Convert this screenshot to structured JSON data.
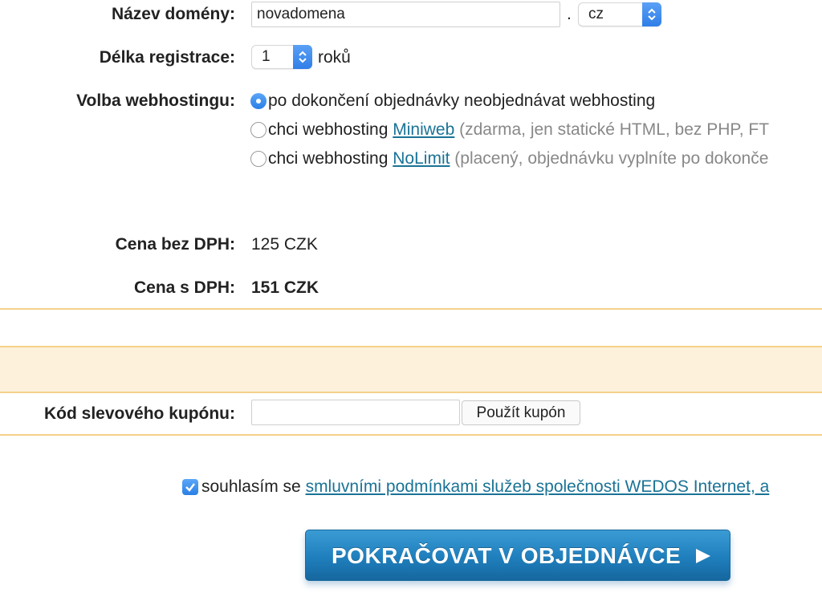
{
  "domain_name": {
    "label": "Název domény:",
    "value": "novadomena",
    "dot": ".",
    "tld": "cz"
  },
  "registration": {
    "label": "Délka registrace:",
    "value": "1",
    "unit": "roků"
  },
  "webhosting": {
    "label": "Volba webhostingu:",
    "options": [
      {
        "text": "po dokončení objednávky neobjednávat webhosting",
        "selected": true
      },
      {
        "prefix": "chci webhosting ",
        "link": "Miniweb",
        "note": " (zdarma, jen statické HTML, bez PHP, FT",
        "selected": false
      },
      {
        "prefix": "chci webhosting ",
        "link": "NoLimit",
        "note": " (placený, objednávku vyplníte po dokonče",
        "selected": false
      }
    ]
  },
  "price": {
    "without_vat_label": "Cena bez DPH:",
    "without_vat": "125 CZK",
    "with_vat_label": "Cena s DPH:",
    "with_vat": "151 CZK"
  },
  "coupon": {
    "label": "Kód slevového kupónu:",
    "value": "",
    "button": "Použít kupón"
  },
  "agreement": {
    "checked": true,
    "text": "souhlasím se ",
    "link": "smluvními podmínkami služeb společnosti WEDOS Internet, a"
  },
  "continue_button": "POKRAČOVAT V OBJEDNÁVCE",
  "colors": {
    "accent_blue": "#2f7ee8",
    "link": "#1a7396",
    "divider": "#f4d089",
    "band": "#fdf1dc",
    "cta": "#1f7fbd"
  }
}
